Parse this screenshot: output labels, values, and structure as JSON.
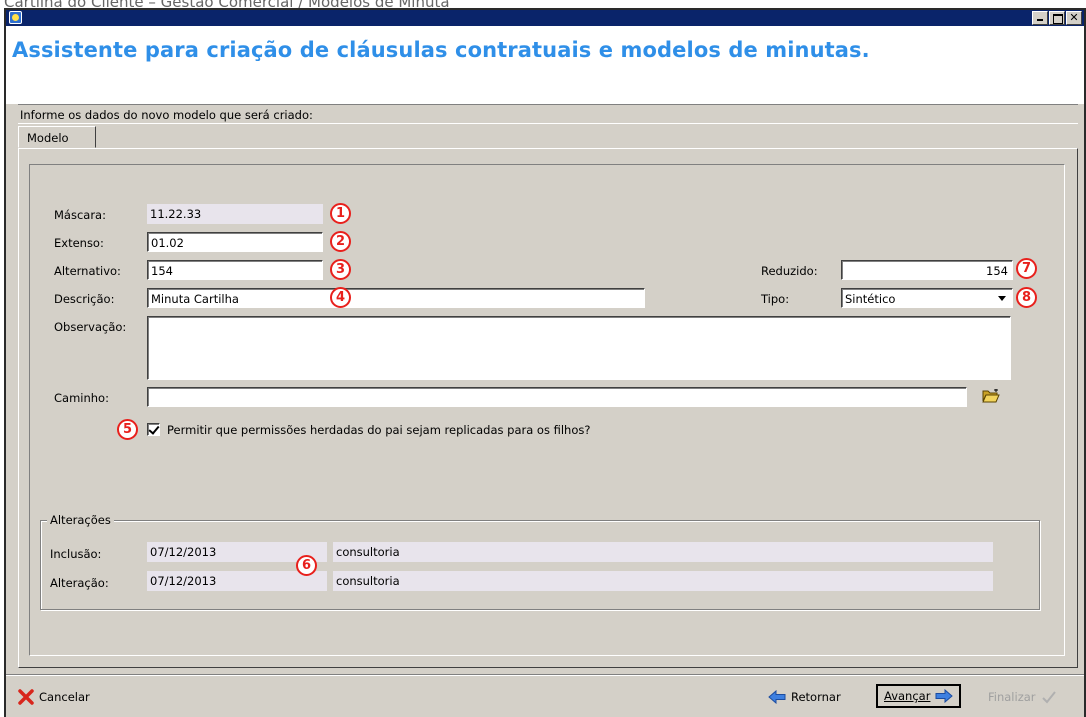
{
  "caption": "Cartilha do Cliente – Gestão Comercial / Modelos de Minuta",
  "window": {
    "title_buttons": {
      "minimize": "minimize-icon",
      "maximize": "maximize-icon",
      "close": "close-icon",
      "close_glyph": "✕"
    }
  },
  "header": {
    "title": "Assistente para criação de cláusulas contratuais e modelos de minutas."
  },
  "instructions": "Informe os dados do novo modelo que será criado:",
  "tabs": [
    {
      "label": "Modelo"
    }
  ],
  "form": {
    "mascara": {
      "label": "Máscara:",
      "value": "11.22.33",
      "badge": "1"
    },
    "extenso": {
      "label": "Extenso:",
      "value": "01.02",
      "badge": "2"
    },
    "alternativo": {
      "label": "Alternativo:",
      "value": "154",
      "badge": "3"
    },
    "descricao": {
      "label": "Descrição:",
      "value": "Minuta Cartilha",
      "badge": "4"
    },
    "reduzido": {
      "label": "Reduzido:",
      "value": "154",
      "badge": "7"
    },
    "tipo": {
      "label": "Tipo:",
      "value": "Sintético",
      "badge": "8"
    },
    "observacao": {
      "label": "Observação:",
      "value": ""
    },
    "caminho": {
      "label": "Caminho:",
      "value": ""
    },
    "permissions": {
      "label": "Permitir que permissões herdadas do pai sejam replicadas para os filhos?",
      "checked": true,
      "badge": "5"
    }
  },
  "alteracoes": {
    "title": "Alterações",
    "badge": "6",
    "inclusao": {
      "label": "Inclusão:",
      "date": "07/12/2013",
      "user": "consultoria"
    },
    "alteracao": {
      "label": "Alteração:",
      "date": "07/12/2013",
      "user": "consultoria"
    }
  },
  "footer": {
    "cancel": {
      "label": "Cancelar",
      "access": "C",
      "icon": "cancel-x-icon"
    },
    "back": {
      "label": "Retornar",
      "access": "R",
      "icon": "arrow-left-icon"
    },
    "next": {
      "label": "Avançar",
      "access": "A",
      "icon": "arrow-right-icon"
    },
    "finish": {
      "label": "Finalizar",
      "access": "F",
      "icon": "checkmark-icon"
    }
  },
  "colors": {
    "title_blue": "#2f8fe8",
    "badge_red": "#e8201c",
    "window_gray": "#d4d0c8",
    "readonly_field": "#e8e4ec"
  }
}
